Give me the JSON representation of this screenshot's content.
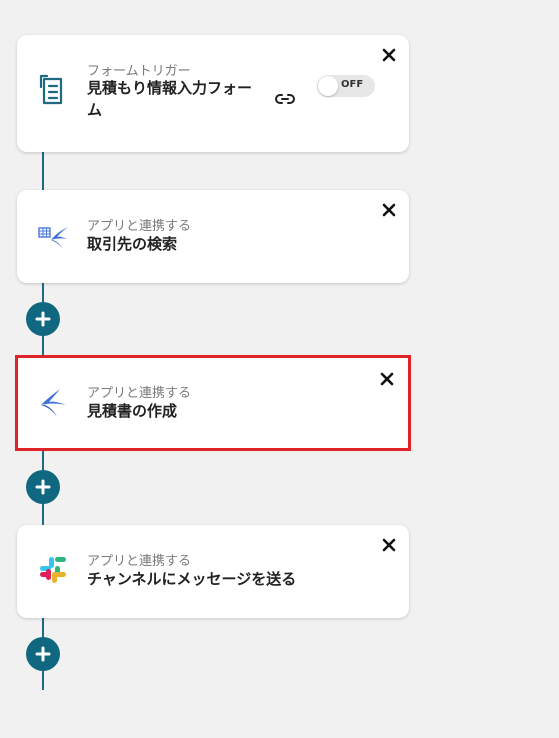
{
  "flow": {
    "steps": [
      {
        "kind": "trigger",
        "subtitle": "フォームトリガー",
        "title": "見積もり情報入力フォーム",
        "icon": "form-icon",
        "toggle_label": "OFF"
      },
      {
        "kind": "app",
        "subtitle": "アプリと連携する",
        "title": "取引先の検索",
        "icon": "spreadsheet-swallow-icon"
      },
      {
        "kind": "app",
        "subtitle": "アプリと連携する",
        "title": "見積書の作成",
        "icon": "swallow-icon",
        "selected": true
      },
      {
        "kind": "app",
        "subtitle": "アプリと連携する",
        "title": "チャンネルにメッセージを送る",
        "icon": "slack-icon"
      }
    ]
  },
  "colors": {
    "background": "#f1f1f1",
    "rail": "#1f6a83",
    "plus_button": "#0f6780",
    "selection_border": "#e02326",
    "swallow_blue": "#3d6fd6"
  }
}
